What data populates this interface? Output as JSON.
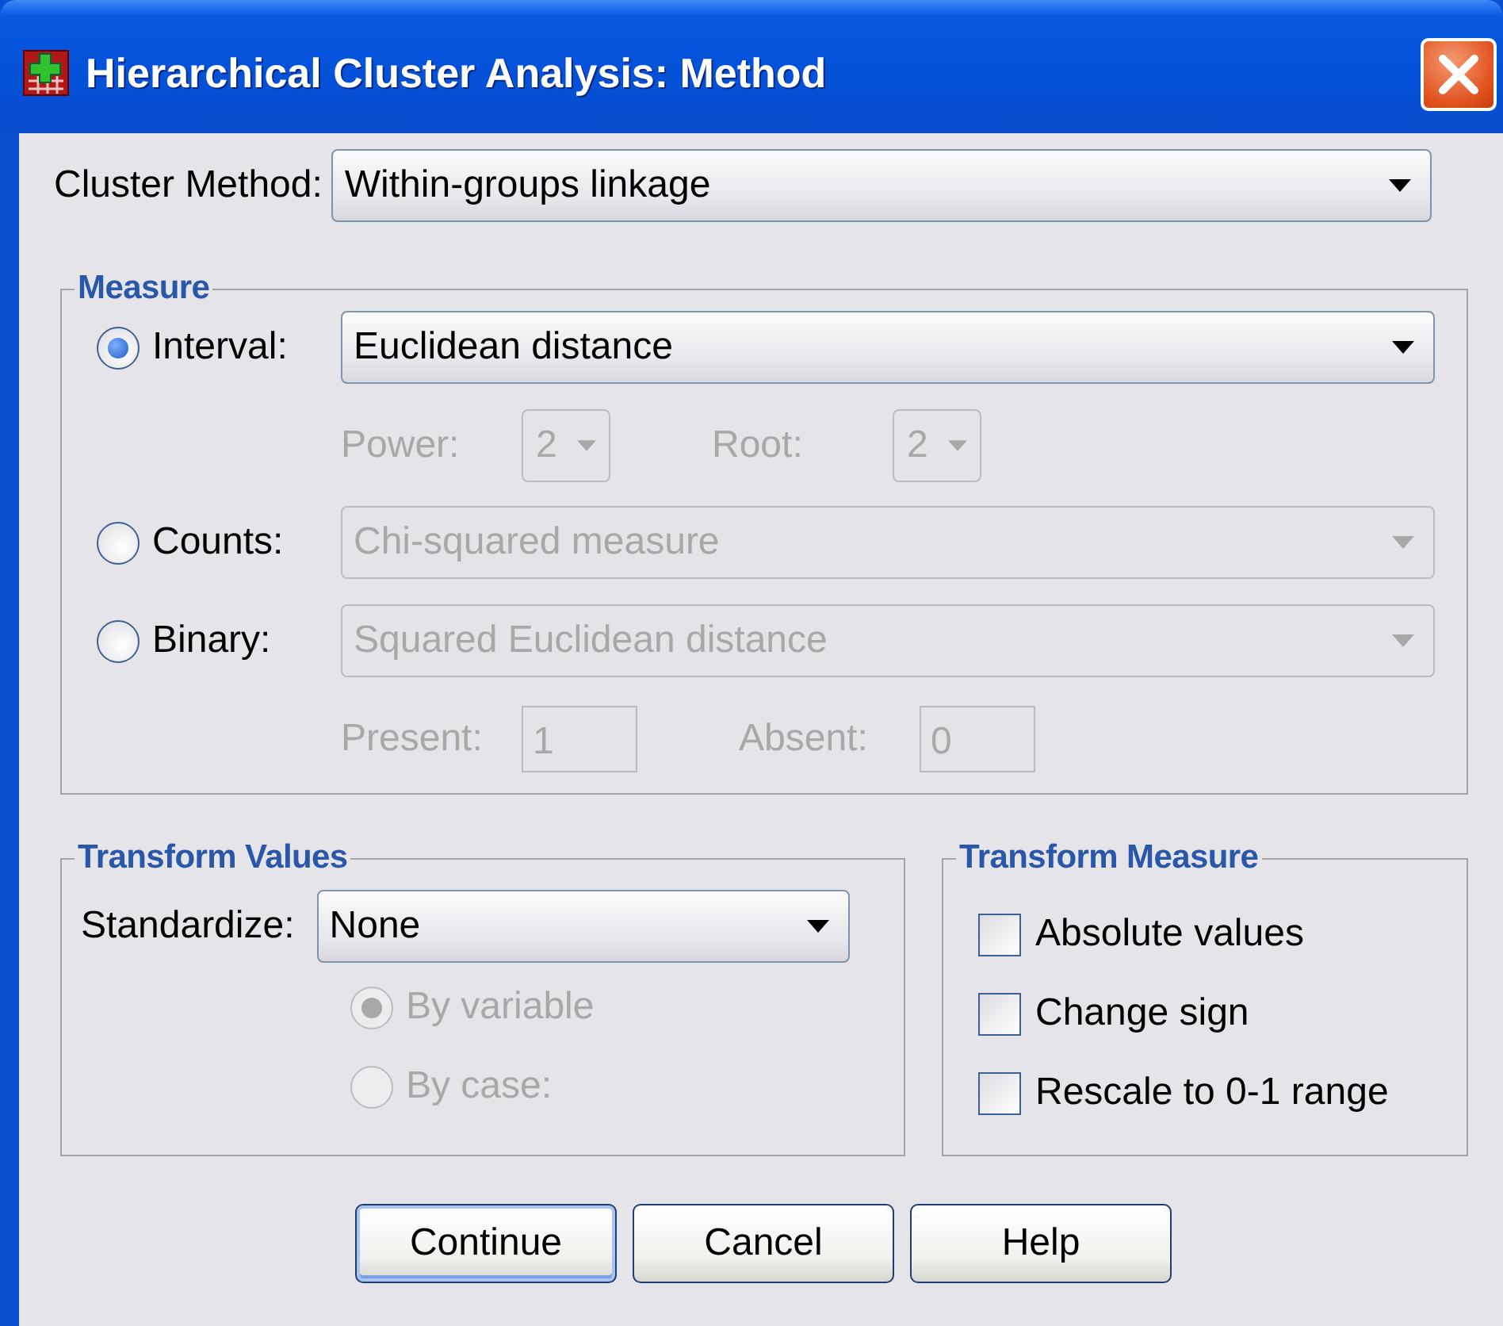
{
  "window": {
    "title": "Hierarchical Cluster Analysis: Method"
  },
  "cluster_method": {
    "label": "Cluster Method:",
    "value": "Within-groups linkage"
  },
  "measure": {
    "title": "Measure",
    "options": [
      {
        "label": "Interval:",
        "selected": true,
        "value": "Euclidean distance",
        "disabled": false
      },
      {
        "label": "Counts:",
        "selected": false,
        "value": "Chi-squared measure",
        "disabled": true
      },
      {
        "label": "Binary:",
        "selected": false,
        "value": "Squared Euclidean distance",
        "disabled": true
      }
    ],
    "interval_params": [
      {
        "label": "Power:",
        "value": "2",
        "disabled": true
      },
      {
        "label": "Root:",
        "value": "2",
        "disabled": true
      }
    ],
    "binary_params": [
      {
        "label": "Present:",
        "value": "1",
        "disabled": true
      },
      {
        "label": "Absent:",
        "value": "0",
        "disabled": true
      }
    ]
  },
  "transform_values": {
    "title": "Transform Values",
    "standardize": {
      "label": "Standardize:",
      "value": "None"
    },
    "options": [
      {
        "label": "By variable",
        "selected": true,
        "disabled": true
      },
      {
        "label": "By case:",
        "selected": false,
        "disabled": true
      }
    ]
  },
  "transform_measure": {
    "title": "Transform Measure",
    "checkboxes": [
      {
        "label": "Absolute values",
        "checked": false
      },
      {
        "label": "Change sign",
        "checked": false
      },
      {
        "label": "Rescale to 0-1 range",
        "checked": false
      }
    ]
  },
  "buttons": [
    {
      "label": "Continue",
      "default": true
    },
    {
      "label": "Cancel",
      "default": false
    },
    {
      "label": "Help",
      "default": false
    }
  ]
}
